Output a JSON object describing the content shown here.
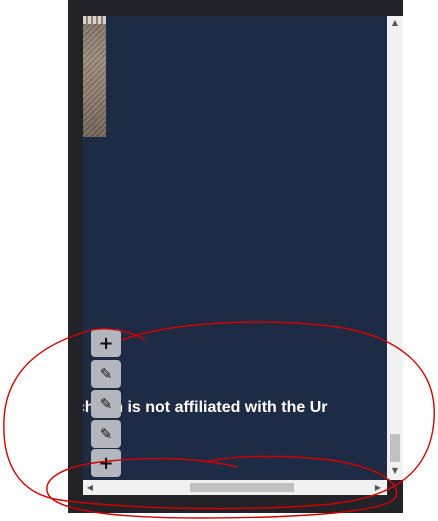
{
  "viewport": {
    "footer_text": "echaun is not affiliated with the Ur"
  },
  "toolbar": {
    "buttons": [
      {
        "icon": "plus-icon",
        "glyph": "+"
      },
      {
        "icon": "pencil-icon",
        "glyph": "✎"
      },
      {
        "icon": "pencil-icon",
        "glyph": "✎"
      },
      {
        "icon": "pencil-icon",
        "glyph": "✎"
      },
      {
        "icon": "plus-icon",
        "glyph": "+"
      }
    ]
  },
  "scrollbars": {
    "up_glyph": "▲",
    "down_glyph": "▼",
    "left_glyph": "◀",
    "right_glyph": "▶"
  },
  "colors": {
    "frame": "#222328",
    "content_bg": "#1e2b45",
    "annotation": "#d40000",
    "button_bg": "#b3b6bc"
  }
}
